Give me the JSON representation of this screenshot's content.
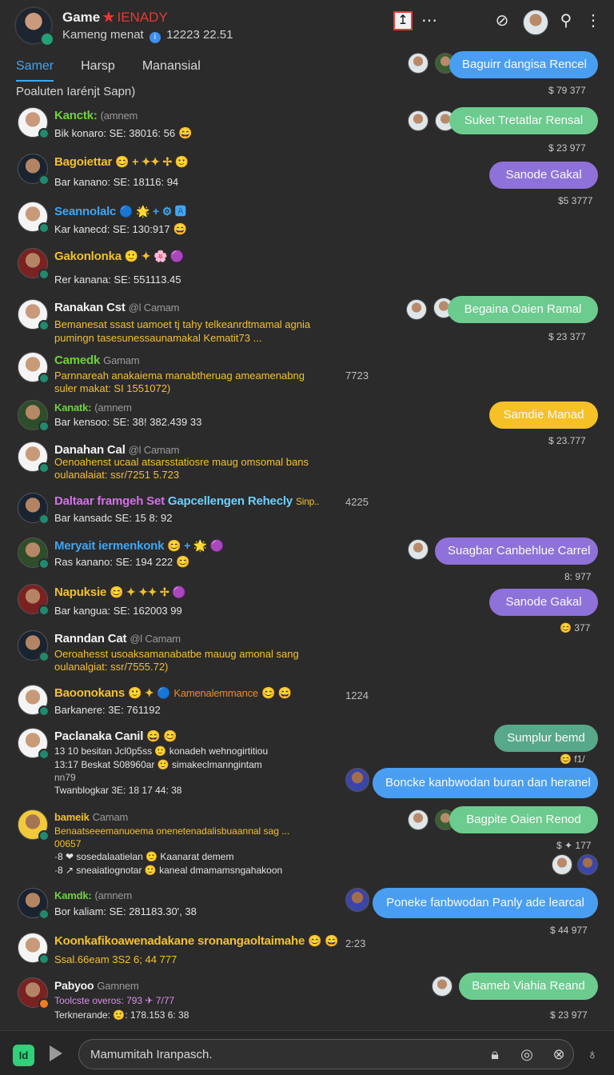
{
  "header": {
    "title": "Game",
    "badge": "IENADY",
    "subtitle_pre": "Kameng menat",
    "subtitle_num": "12223 22.51"
  },
  "tabs": [
    {
      "label": "Samer",
      "active": true
    },
    {
      "label": "Harsp",
      "active": false
    },
    {
      "label": "Manansial",
      "active": false
    }
  ],
  "section_label": "Poaluten Iarénjt Sapn)",
  "rows": [
    {
      "name": "Kanctk:",
      "handle": "(amnem",
      "line1": "Bik konaro: SE: 38016: 56",
      "e1": "😄",
      "color": "green"
    },
    {
      "name": "Bagoiettar",
      "line1": "Bar kanano: SE: 18116: 94",
      "e1": "😊 + ✦✦ ✢ 🙂",
      "color": "yellow"
    },
    {
      "name": "Seannolalc",
      "line1": "Kar kanecd: SE: 130:917",
      "e1": "🔵 🌟 + ⚙ 🅰",
      "e2": "😄",
      "color": "blue"
    },
    {
      "name": "Gakonlonka",
      "line1": "Rer kanana: SE: 551113.45",
      "e1": "🙂 ✦ 🌸 🟣",
      "color": "yellow"
    },
    {
      "name": "Ranakan Cst",
      "handle": "@l Camam",
      "line1": "Bemanesat ssast uamoet tj tahy telkeanrdtmamal agnia",
      "line2": "pumingn tasesunessaunamakal Kematit73 ...",
      "color": "white"
    },
    {
      "name": "Camedk",
      "handle": "Gamam",
      "line1": "Parnnareah anakaiema manabtheruag ameamenabng",
      "line2": "suler makat: SI 1551072)",
      "time": "7723",
      "color": "green"
    },
    {
      "name": "Kanatk:",
      "handle": "(amnem",
      "line1": "Bar kensoo: SE: 38! 382.439 33",
      "color": "green"
    },
    {
      "name": "Danahan Cal",
      "handle": "@l Camam",
      "line1": "Oenoahenst ucaal atsarsstatiosre maug omsomal bans",
      "line2": "oulanalaiat: ssr/7251 5.723",
      "color": "white"
    },
    {
      "name": "Daltaar framgeh Set",
      "extra": "Gapcellengen Rehecly",
      "extra2": "Sinp..",
      "line1": "Bar kansadc SE: 15 8: 92",
      "time": "4225",
      "color": "yellow"
    },
    {
      "name": "Meryait iermenkonk",
      "line1": "Ras kanano: SE: 194 222",
      "e1": "😊 + 🌟 🟣",
      "e2": "😊",
      "color": "blue"
    },
    {
      "name": "Napuksie",
      "line1": "Bar kangua: SE: 162003 99",
      "e1": "😊 ✦ ✦✦ ✢ 🟣",
      "color": "yellow"
    },
    {
      "name": "Ranndan Cat",
      "handle": "@l Camam",
      "line1": "Oeroahesst usoaksamanabatbe mauug amonal sang",
      "line2": "oulanalgiat: ssr/7555.72)",
      "color": "white"
    },
    {
      "name": "Baoonokans",
      "extra": "Kamenalemmance",
      "line1": "Barkanere: 3E: 761192",
      "e1": "🙂 ✦ 🔵",
      "e2": "😊 😄",
      "time": "1224",
      "color": "yellow"
    },
    {
      "name": "Paclanaka Canil",
      "line1": "13 10 besitan Jcl0p5ss",
      "line1b": "konadeh wehnogirtitiou",
      "line2": "13:17 Beskat S08960ar",
      "line2b": "simakeclmanngintam",
      "line3": "nn79",
      "line4": "Twanblogkar 3E: 18 17 44: 38",
      "e1": "😄 😊",
      "color": "white"
    },
    {
      "name": "bameik",
      "handle": "Camam",
      "line1": "Benaatseeemanuoema onenetenadalisbuaannal sag ...",
      "line2": "00657",
      "line3": "sosedalaatielan",
      "line3b": "Kaanarat demem",
      "line4": "sneaiatiognotar",
      "line4b": "kaneal dmamamsngahakoon",
      "color": "yellow"
    },
    {
      "name": "Kamdk:",
      "handle": "(amnem",
      "line1": "Bor kaliam: SE: 281183.30', 38",
      "color": "green"
    },
    {
      "name": "Koonkafikoawenadakane sronangaoltaimahe",
      "line1": "Ssal.66eam 3S2 6; 44 777",
      "e2": "😊 😄",
      "time": "2:23",
      "color": "yellow"
    },
    {
      "name": "Pabyoo",
      "handle": "Gamnem",
      "line1": "Toolcste overos:",
      "line1b": "793",
      "line1c": "7/77",
      "line2": "Terknerande:",
      "line2b": "178.153 6: 38",
      "color": "white"
    }
  ],
  "bubbles": [
    {
      "text": "Baguirr dangisa Rencel",
      "meta": "$ 79 377"
    },
    {
      "text": "Suket Tretatlar Rensal",
      "meta": "$ 23 977"
    },
    {
      "text": "Sanode Gakal",
      "meta": "$5 3777"
    },
    {
      "text": "Begaina Oaien Ramal",
      "meta": "$ 23 377"
    },
    {
      "text": "Samdie Manad",
      "meta": "$ 23.777"
    },
    {
      "text": "Suagbar Canbehlue Carrel",
      "meta": "8: 977"
    },
    {
      "text": "Sanode Gakal",
      "meta": "377"
    },
    {
      "text": "Sumplur bemd",
      "meta": "f1/"
    },
    {
      "text": "Boncke kanbwodan buran dan heranel",
      "meta": ""
    },
    {
      "text": "Bagpite Oaien Renod",
      "meta": "$ ✦ 177"
    },
    {
      "text": "Poneke fanbwodan Panly ade learcal",
      "meta": "$ 44 977"
    },
    {
      "text": "Bameb Viahia Reand",
      "meta": "$ 23 977"
    }
  ],
  "composer": {
    "badge": "Id",
    "placeholder": "Mamumitah Iranpasch."
  },
  "icons": [
    "info-icon",
    "upload-icon",
    "more-icon",
    "mic-off-icon",
    "tool-icon",
    "menu-icon",
    "play-icon",
    "lock-icon",
    "camera-icon",
    "mute-icon",
    "lightbulb-icon"
  ],
  "colors": {
    "accent_blue": "#3fa6f5",
    "green_name": "#6fd13a",
    "yellow_name": "#f2c02e",
    "bubble_blue": "#4a9ef2",
    "bubble_green": "#6ccb8e",
    "bubble_purple": "#8e72d9",
    "bubble_yellow": "#f5c126",
    "online_dot": "#1f8a6e"
  }
}
